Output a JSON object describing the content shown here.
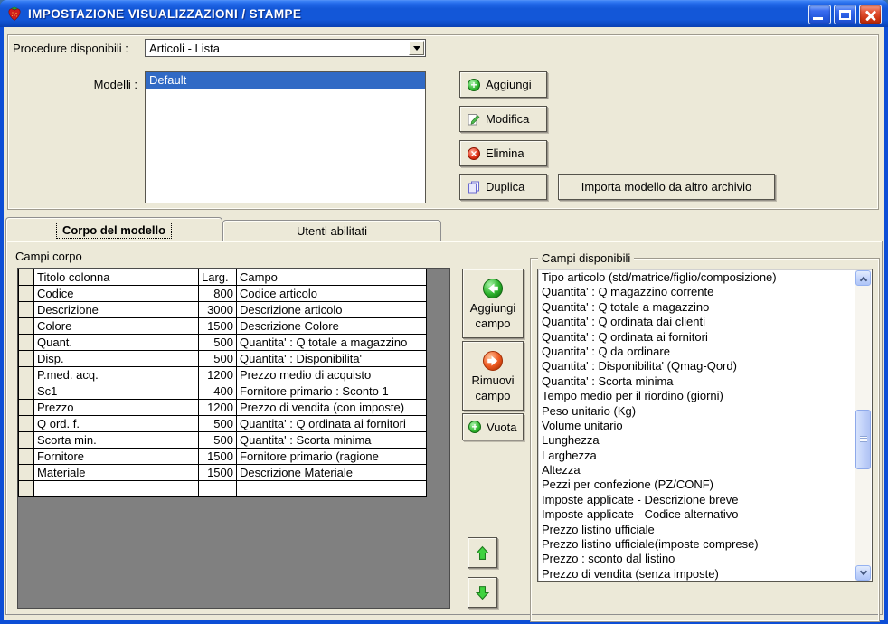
{
  "window": {
    "title": "IMPOSTAZIONE VISUALIZZAZIONI / STAMPE",
    "app_icon": "strawberry-icon"
  },
  "colors": {
    "titlebar_blue": "#1357d8",
    "dialog_bg": "#ece9d8",
    "selection_blue": "#316ac5",
    "grid_filler_gray": "#808080",
    "accent_green": "#2eb52e",
    "accent_red": "#de2c12",
    "accent_orange": "#e8622d"
  },
  "top_section": {
    "procedure_label": "Procedure disponibili :",
    "procedure_value": "Articoli - Lista",
    "modelli_label": "Modelli :",
    "modelli_items": [
      {
        "label": "Default",
        "selected": true
      }
    ],
    "buttons": {
      "aggiungi": "Aggiungi",
      "modifica": "Modifica",
      "elimina": "Elimina",
      "duplica": "Duplica",
      "importa": "Importa modello da altro archivio"
    }
  },
  "tabs": [
    {
      "label": "Corpo del modello",
      "active": true
    },
    {
      "label": "Utenti abilitati",
      "active": false
    }
  ],
  "corpo": {
    "section_label": "Campi corpo",
    "table": {
      "headers": [
        "Titolo colonna",
        "Larg.",
        "Campo"
      ],
      "rows": [
        [
          "Codice",
          "800",
          "Codice articolo"
        ],
        [
          "Descrizione",
          "3000",
          "Descrizione articolo"
        ],
        [
          "Colore",
          "1500",
          "Descrizione Colore"
        ],
        [
          "Quant.",
          "500",
          "Quantita' : Q totale a magazzino"
        ],
        [
          "Disp.",
          "500",
          "Quantita' : Disponibilita'"
        ],
        [
          "P.med. acq.",
          "1200",
          "Prezzo medio di acquisto"
        ],
        [
          "Sc1",
          "400",
          "Fornitore primario : Sconto 1"
        ],
        [
          "Prezzo",
          "1200",
          "Prezzo di vendita (con imposte)"
        ],
        [
          "Q ord. f.",
          "500",
          "Quantita' : Q ordinata ai fornitori"
        ],
        [
          "Scorta min.",
          "500",
          "Quantita' : Scorta minima"
        ],
        [
          "Fornitore",
          "1500",
          "Fornitore primario (ragione"
        ],
        [
          "Materiale",
          "1500",
          "Descrizione Materiale"
        ]
      ]
    },
    "buttons": {
      "aggiungi_campo_line1": "Aggiungi",
      "aggiungi_campo_line2": "campo",
      "rimuovi_campo_line1": "Rimuovi",
      "rimuovi_campo_line2": "campo",
      "vuota": "Vuota"
    },
    "campi_disponibili": {
      "label": "Campi disponibili",
      "items": [
        "Tipo articolo (std/matrice/figlio/composizione)",
        "Quantita' : Q magazzino corrente",
        "Quantita' : Q totale a magazzino",
        "Quantita' : Q ordinata dai clienti",
        "Quantita' : Q ordinata ai fornitori",
        "Quantita' : Q da ordinare",
        "Quantita' : Disponibilita' (Qmag-Qord)",
        "Quantita' : Scorta minima",
        "Tempo medio per il riordino (giorni)",
        "Peso unitario (Kg)",
        "Volume unitario",
        "Lunghezza",
        "Larghezza",
        "Altezza",
        "Pezzi per confezione (PZ/CONF)",
        "Imposte applicate - Descrizione breve",
        "Imposte applicate - Codice alternativo",
        "Prezzo listino ufficiale",
        "Prezzo listino ufficiale(imposte comprese)",
        "Prezzo : sconto dal listino",
        "Prezzo di vendita (senza imposte)"
      ]
    }
  }
}
